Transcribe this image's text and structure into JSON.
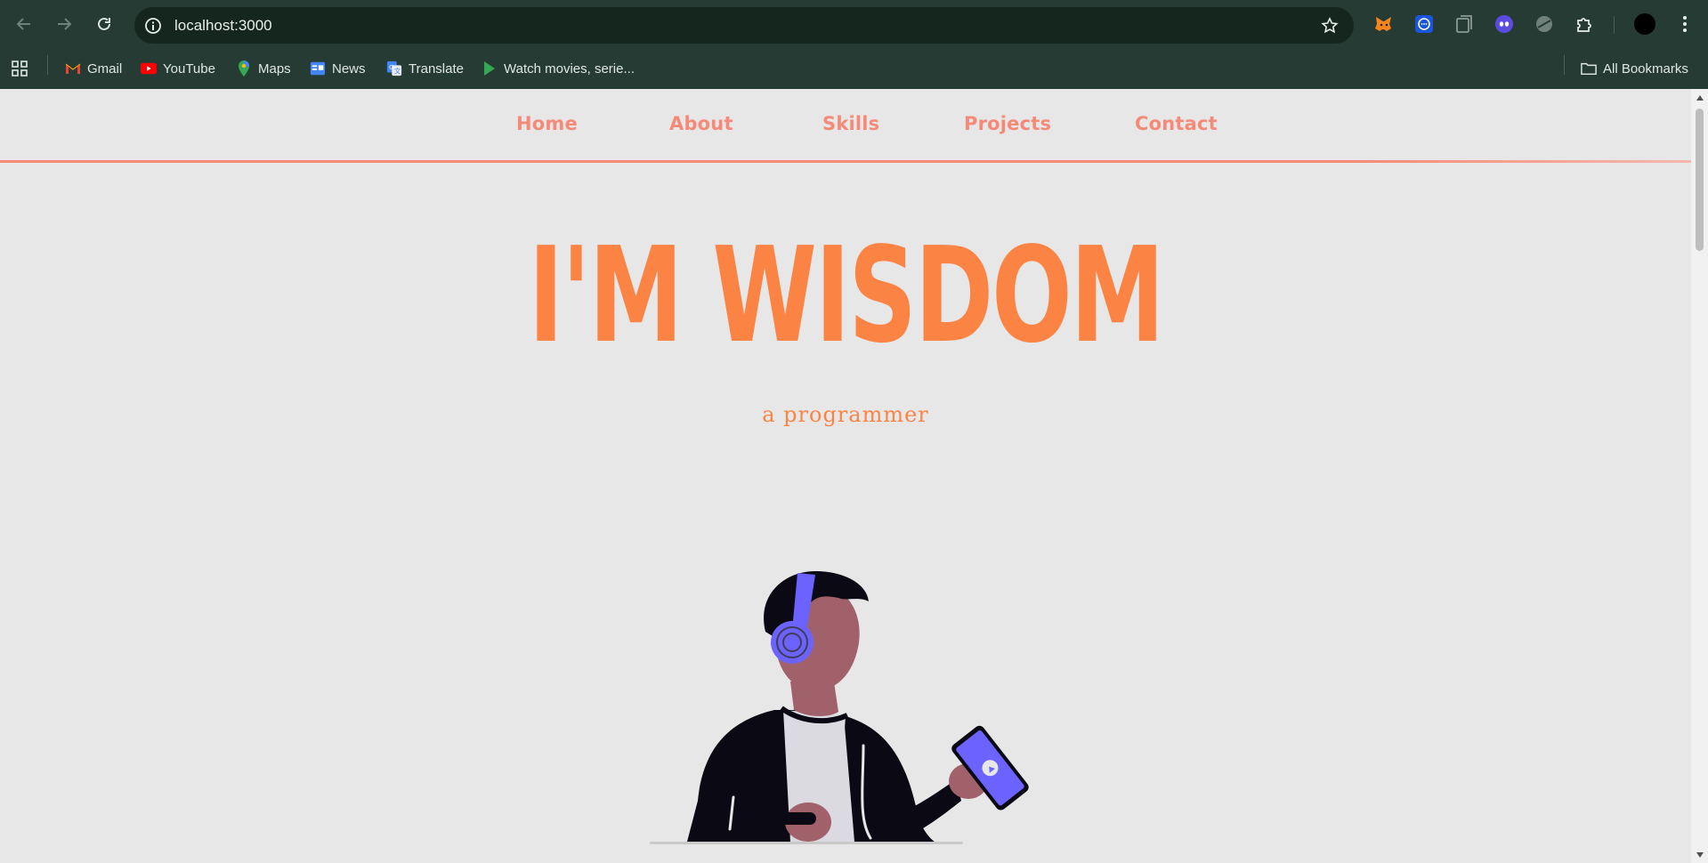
{
  "browser": {
    "url": "localhost:3000",
    "bookmarks": [
      {
        "label": "Gmail",
        "icon": "gmail-icon"
      },
      {
        "label": "YouTube",
        "icon": "youtube-icon"
      },
      {
        "label": "Maps",
        "icon": "maps-icon"
      },
      {
        "label": "News",
        "icon": "news-icon"
      },
      {
        "label": "Translate",
        "icon": "translate-icon"
      },
      {
        "label": "Watch movies, serie...",
        "icon": "play-icon"
      }
    ],
    "all_bookmarks": "All Bookmarks"
  },
  "site": {
    "nav": [
      {
        "label": "Home"
      },
      {
        "label": "About"
      },
      {
        "label": "Skills"
      },
      {
        "label": "Projects"
      },
      {
        "label": "Contact"
      }
    ],
    "hero_title": "I'M WISDOM",
    "hero_subtitle": "a programmer"
  },
  "colors": {
    "accent": "#f68a78",
    "title": "#fb8445",
    "chrome": "#263b33",
    "page_bg": "#e8e7e7",
    "headphones": "#6c63ff"
  }
}
